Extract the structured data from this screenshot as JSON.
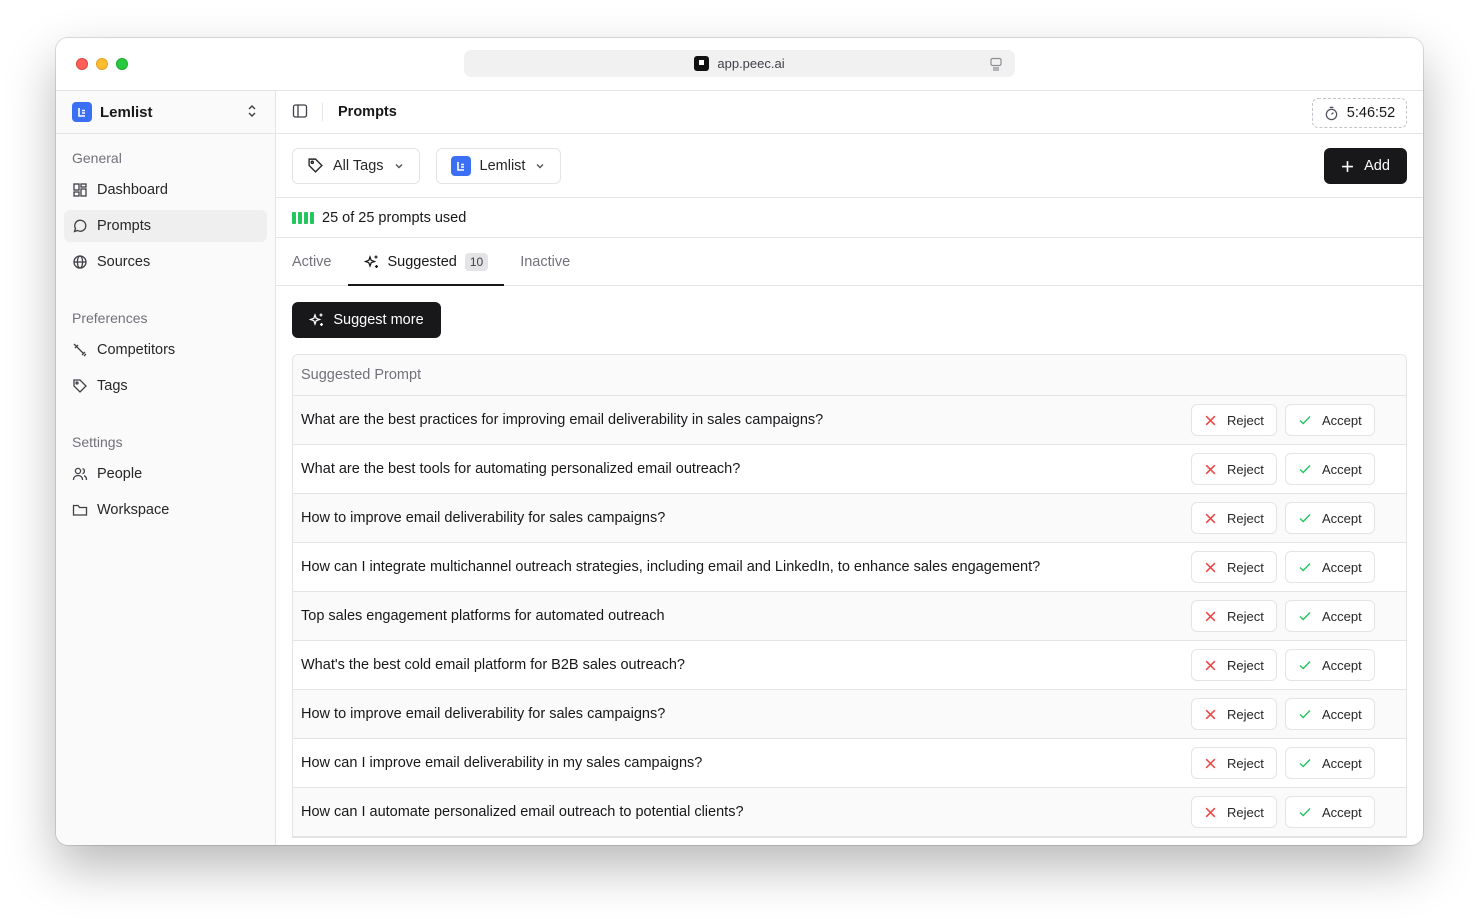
{
  "browser": {
    "url": "app.peec.ai"
  },
  "colors": {
    "accent": "#3b6ff5",
    "primary": "#18181b",
    "success": "#22c55e",
    "danger": "#ef4444"
  },
  "sidebar": {
    "workspace": "Lemlist",
    "sections": [
      {
        "heading": "General",
        "items": [
          {
            "label": "Dashboard",
            "icon": "dashboard-icon"
          },
          {
            "label": "Prompts",
            "icon": "message-circle-icon",
            "active": true
          },
          {
            "label": "Sources",
            "icon": "globe-icon"
          }
        ]
      },
      {
        "heading": "Preferences",
        "items": [
          {
            "label": "Competitors",
            "icon": "swords-icon"
          },
          {
            "label": "Tags",
            "icon": "tag-icon"
          }
        ]
      },
      {
        "heading": "Settings",
        "items": [
          {
            "label": "People",
            "icon": "users-icon"
          },
          {
            "label": "Workspace",
            "icon": "folder-icon"
          }
        ]
      }
    ]
  },
  "header": {
    "title": "Prompts",
    "timer": "5:46:52"
  },
  "filters": {
    "tags": "All Tags",
    "brand": "Lemlist",
    "add": "Add"
  },
  "usage": {
    "text": "25 of 25 prompts used",
    "used": 25,
    "total": 25
  },
  "tabs": [
    {
      "label": "Active"
    },
    {
      "label": "Suggested",
      "badge": "10",
      "active": true
    },
    {
      "label": "Inactive"
    }
  ],
  "suggest_button": "Suggest more",
  "table": {
    "header": "Suggested Prompt",
    "reject_label": "Reject",
    "accept_label": "Accept",
    "rows": [
      "What are the best practices for improving email deliverability in sales campaigns?",
      "What are the best tools for automating personalized email outreach?",
      "How to improve email deliverability for sales campaigns?",
      "How can I integrate multichannel outreach strategies, including email and LinkedIn, to enhance sales engagement?",
      "Top sales engagement platforms for automated outreach",
      "What's the best cold email platform for B2B sales outreach?",
      "How to improve email deliverability for sales campaigns?",
      "How can I improve email deliverability in my sales campaigns?",
      "How can I automate personalized email outreach to potential clients?"
    ]
  }
}
